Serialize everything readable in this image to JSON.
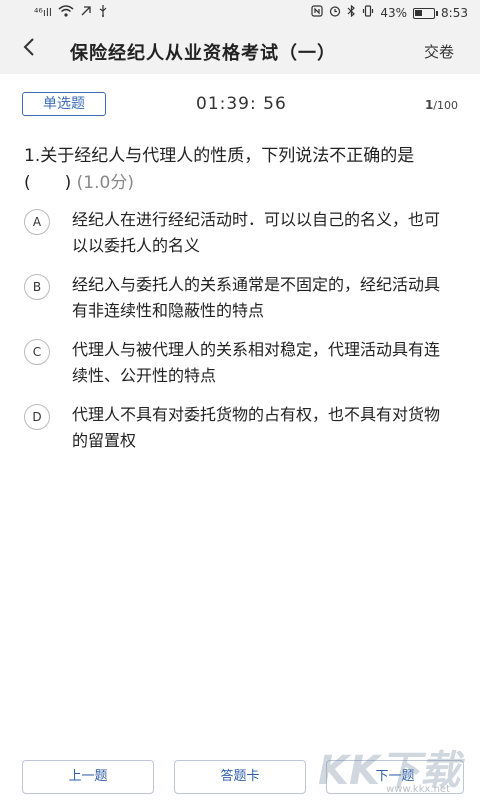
{
  "status_bar": {
    "signal": "⁴⁶ıll",
    "battery_percent": "43%",
    "battery_level": 0.43,
    "time": "8:53"
  },
  "header": {
    "title": "保险经纪人从业资格考试（一）",
    "submit_label": "交卷"
  },
  "quiz": {
    "question_type": "单选题",
    "timer": "01:39: 56",
    "current": "1",
    "total": "/100",
    "question_text": "1.关于经纪人与代理人的性质，下列说法不正确的是(　　)",
    "score": "(1.0分)",
    "options": [
      {
        "letter": "A",
        "text": "经纪人在进行经纪活动时．可以以自己的名义，也可以以委托人的名义"
      },
      {
        "letter": "B",
        "text": "经纪入与委托人的关系通常是不固定的，经纪活动具有非连续性和隐蔽性的特点"
      },
      {
        "letter": "C",
        "text": "代理人与被代理人的关系相对稳定，代理活动具有连续性、公开性的特点"
      },
      {
        "letter": "D",
        "text": "代理人不具有对委托货物的占有权，也不具有对货物的留置权"
      }
    ]
  },
  "bottom_bar": {
    "prev_label": "上一题",
    "card_label": "答题卡",
    "next_label": "下一题"
  },
  "watermark": {
    "logo": "KK下载",
    "url": "www.kkx.net"
  }
}
